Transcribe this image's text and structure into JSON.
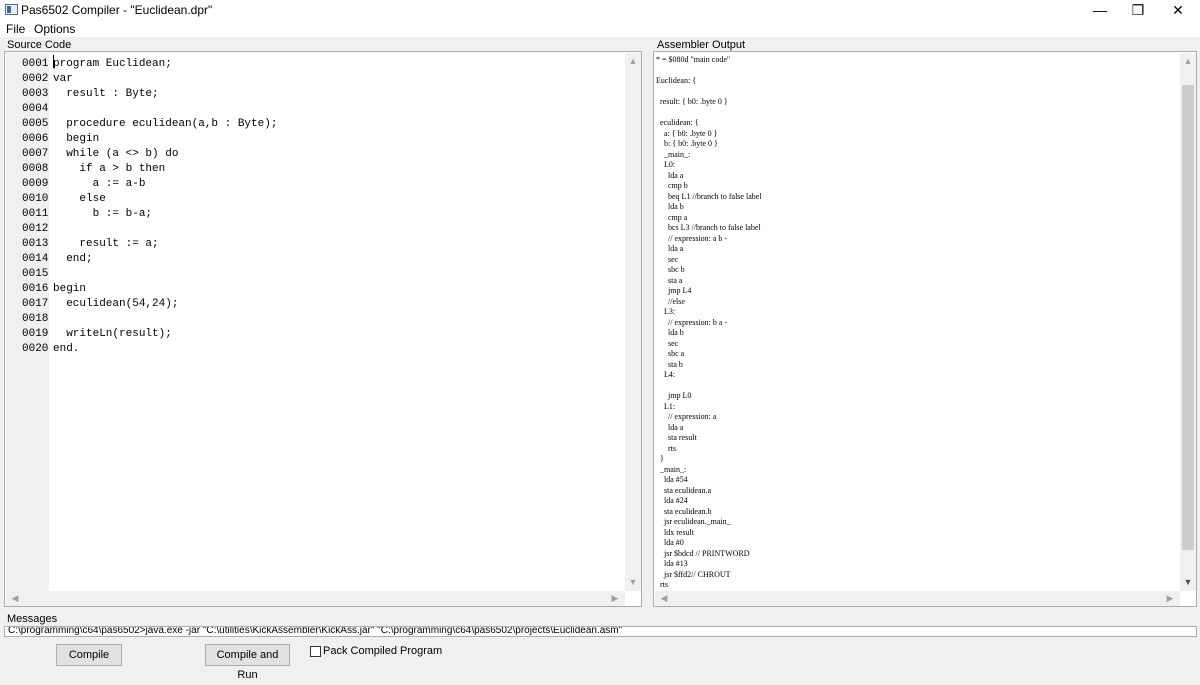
{
  "window": {
    "title": "Pas6502 Compiler - \"Euclidean.dpr\"",
    "minimize_glyph": "—",
    "maximize_glyph": "❐",
    "close_glyph": "✕"
  },
  "menu": {
    "file": "File",
    "options": "Options"
  },
  "source_panel": {
    "label": "Source Code",
    "lines": [
      {
        "num": "0001",
        "text": "program Euclidean;"
      },
      {
        "num": "0002",
        "text": "var"
      },
      {
        "num": "0003",
        "text": "  result : Byte;"
      },
      {
        "num": "0004",
        "text": ""
      },
      {
        "num": "0005",
        "text": "  procedure eculidean(a,b : Byte);"
      },
      {
        "num": "0006",
        "text": "  begin"
      },
      {
        "num": "0007",
        "text": "  while (a <> b) do"
      },
      {
        "num": "0008",
        "text": "    if a > b then"
      },
      {
        "num": "0009",
        "text": "      a := a-b"
      },
      {
        "num": "0010",
        "text": "    else"
      },
      {
        "num": "0011",
        "text": "      b := b-a;"
      },
      {
        "num": "0012",
        "text": ""
      },
      {
        "num": "0013",
        "text": "    result := a;"
      },
      {
        "num": "0014",
        "text": "  end;"
      },
      {
        "num": "0015",
        "text": ""
      },
      {
        "num": "0016",
        "text": "begin"
      },
      {
        "num": "0017",
        "text": "  eculidean(54,24);"
      },
      {
        "num": "0018",
        "text": ""
      },
      {
        "num": "0019",
        "text": "  writeLn(result);"
      },
      {
        "num": "0020",
        "text": "end."
      }
    ]
  },
  "assembler_panel": {
    "label": "Assembler Output",
    "lines": [
      "* = $080d \"main code\"",
      "",
      "Euclidean: {",
      "",
      "  result: { b0: .byte 0 }",
      "",
      "  eculidean: {",
      "    a: { b0: .byte 0 }",
      "    b: { b0: .byte 0 }",
      "    _main_:",
      "    L0:",
      "      lda a",
      "      cmp b",
      "      beq L1 //branch to false label",
      "      lda b",
      "      cmp a",
      "      bcs L3 //branch to false label",
      "      // expression: a b -",
      "      lda a",
      "      sec",
      "      sbc b",
      "      sta a",
      "      jmp L4",
      "      //else",
      "    L3:",
      "      // expression: b a -",
      "      lda b",
      "      sec",
      "      sbc a",
      "      sta b",
      "    L4:",
      "",
      "      jmp L0",
      "    L1:",
      "      // expression: a",
      "      lda a",
      "      sta result",
      "      rts",
      "  }",
      "  _main_:",
      "    lda #54",
      "    sta eculidean.a",
      "    lda #24",
      "    sta eculidean.b",
      "    jsr eculidean._main_",
      "    ldx result",
      "    lda #0",
      "    jsr $bdcd // PRINTWORD",
      "    lda #13",
      "    jsr $ffd2// CHROUT",
      "  rts"
    ]
  },
  "messages": {
    "label": "Messages",
    "text": "C:\\programming\\c64\\pas6502>java.exe -jar \"C:\\utilities\\KickAssembler\\KickAss.jar\" \"C:\\programming\\c64\\pas6502\\projects\\Euclidean.asm\""
  },
  "buttons": {
    "compile": "Compile",
    "compile_and_run": "Compile and Run",
    "pack_label": "Pack Compiled Program"
  },
  "scroll_arrows": {
    "up": "▲",
    "down": "▼",
    "left": "◀",
    "right": "▶"
  }
}
